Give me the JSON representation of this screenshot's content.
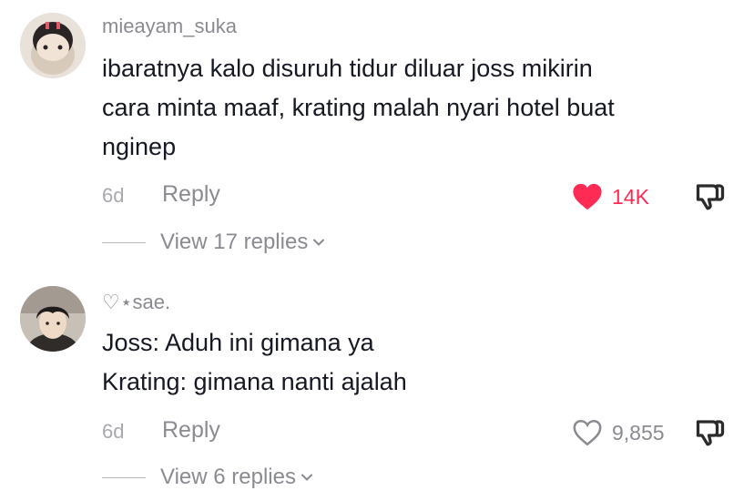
{
  "comments": [
    {
      "username": "mieayam_suka",
      "text_lines": [
        "ibaratnya kalo disuruh tidur diluar joss mikirin",
        "cara minta maaf, krating malah nyari hotel buat",
        "nginep"
      ],
      "age": "6d",
      "reply_label": "Reply",
      "like_count": "14K",
      "liked": true,
      "view_replies": "View 17 replies"
    },
    {
      "username": "♡⋆sae.",
      "text_lines": [
        "Joss: Aduh ini gimana ya",
        "Krating: gimana nanti ajalah"
      ],
      "age": "6d",
      "reply_label": "Reply",
      "like_count": "9,855",
      "liked": false,
      "view_replies": "View 6 replies"
    }
  ],
  "colors": {
    "like_active": "#fe2c55",
    "muted": "#8a8b91"
  },
  "icons": {
    "like": "heart-icon",
    "dislike": "thumbs-down-icon",
    "expand": "chevron-down-icon"
  }
}
